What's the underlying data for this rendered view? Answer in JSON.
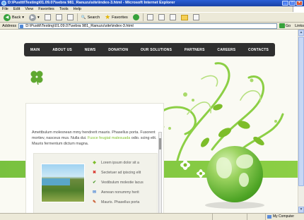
{
  "window": {
    "title": "D:\\Pusttt\\Testing\\01.09.07\\sebra 981_Ranuzu\\site\\index-3.html - Microsoft Internet Explorer",
    "controls": {
      "minimize": "_",
      "maximize": "□",
      "close": "×"
    }
  },
  "menu": [
    "File",
    "Edit",
    "View",
    "Favorites",
    "Tools",
    "Help"
  ],
  "toolbar": {
    "back": "Back",
    "search": "Search",
    "favorites": "Favorites"
  },
  "address": {
    "label": "Address",
    "value": "D:\\Pusttt\\Testing\\01.09.07\\sebra 981_Ranuzu\\site\\index-3.html",
    "go": "Go",
    "links": "Links"
  },
  "nav": [
    "MAIN",
    "ABOUT US",
    "NEWS",
    "DONATION",
    "OUR SOLUTIONS",
    "PARTNERS",
    "CAREERS",
    "CONTACTS"
  ],
  "intro": {
    "text_a": "Amettbulum molesnean mmy hendrerit mauris. Phasellus porta. Fusorent mortiev, nasceus mus. Nulla dui.",
    "text_highlight": "Fusce feugiat malesuada",
    "text_b": "odio. scing elit. Mauris fermentum dictum magna."
  },
  "features": [
    {
      "label": "Lorem ipsum dolor sit a",
      "icon": "diamond-icon",
      "color": "#7dbd2a"
    },
    {
      "label": "Sectetuer ad ipiscing elit",
      "icon": "cross-icon",
      "color": "#d9332b"
    },
    {
      "label": "Vestibulum molestie lacus",
      "icon": "check-icon",
      "color": "#4c9a2a"
    },
    {
      "label": "Aenean nonummy herit",
      "icon": "envelope-icon",
      "color": "#4c86d6"
    },
    {
      "label": "Mauris. Phasellus porta",
      "icon": "pencil-icon",
      "color": "#c9572b"
    }
  ],
  "status": {
    "zone": "My Computer"
  },
  "colors": {
    "accent_green": "#7dbd2a",
    "nav_bg": "#2f2f2f",
    "ie_blue": "#1941a5"
  }
}
